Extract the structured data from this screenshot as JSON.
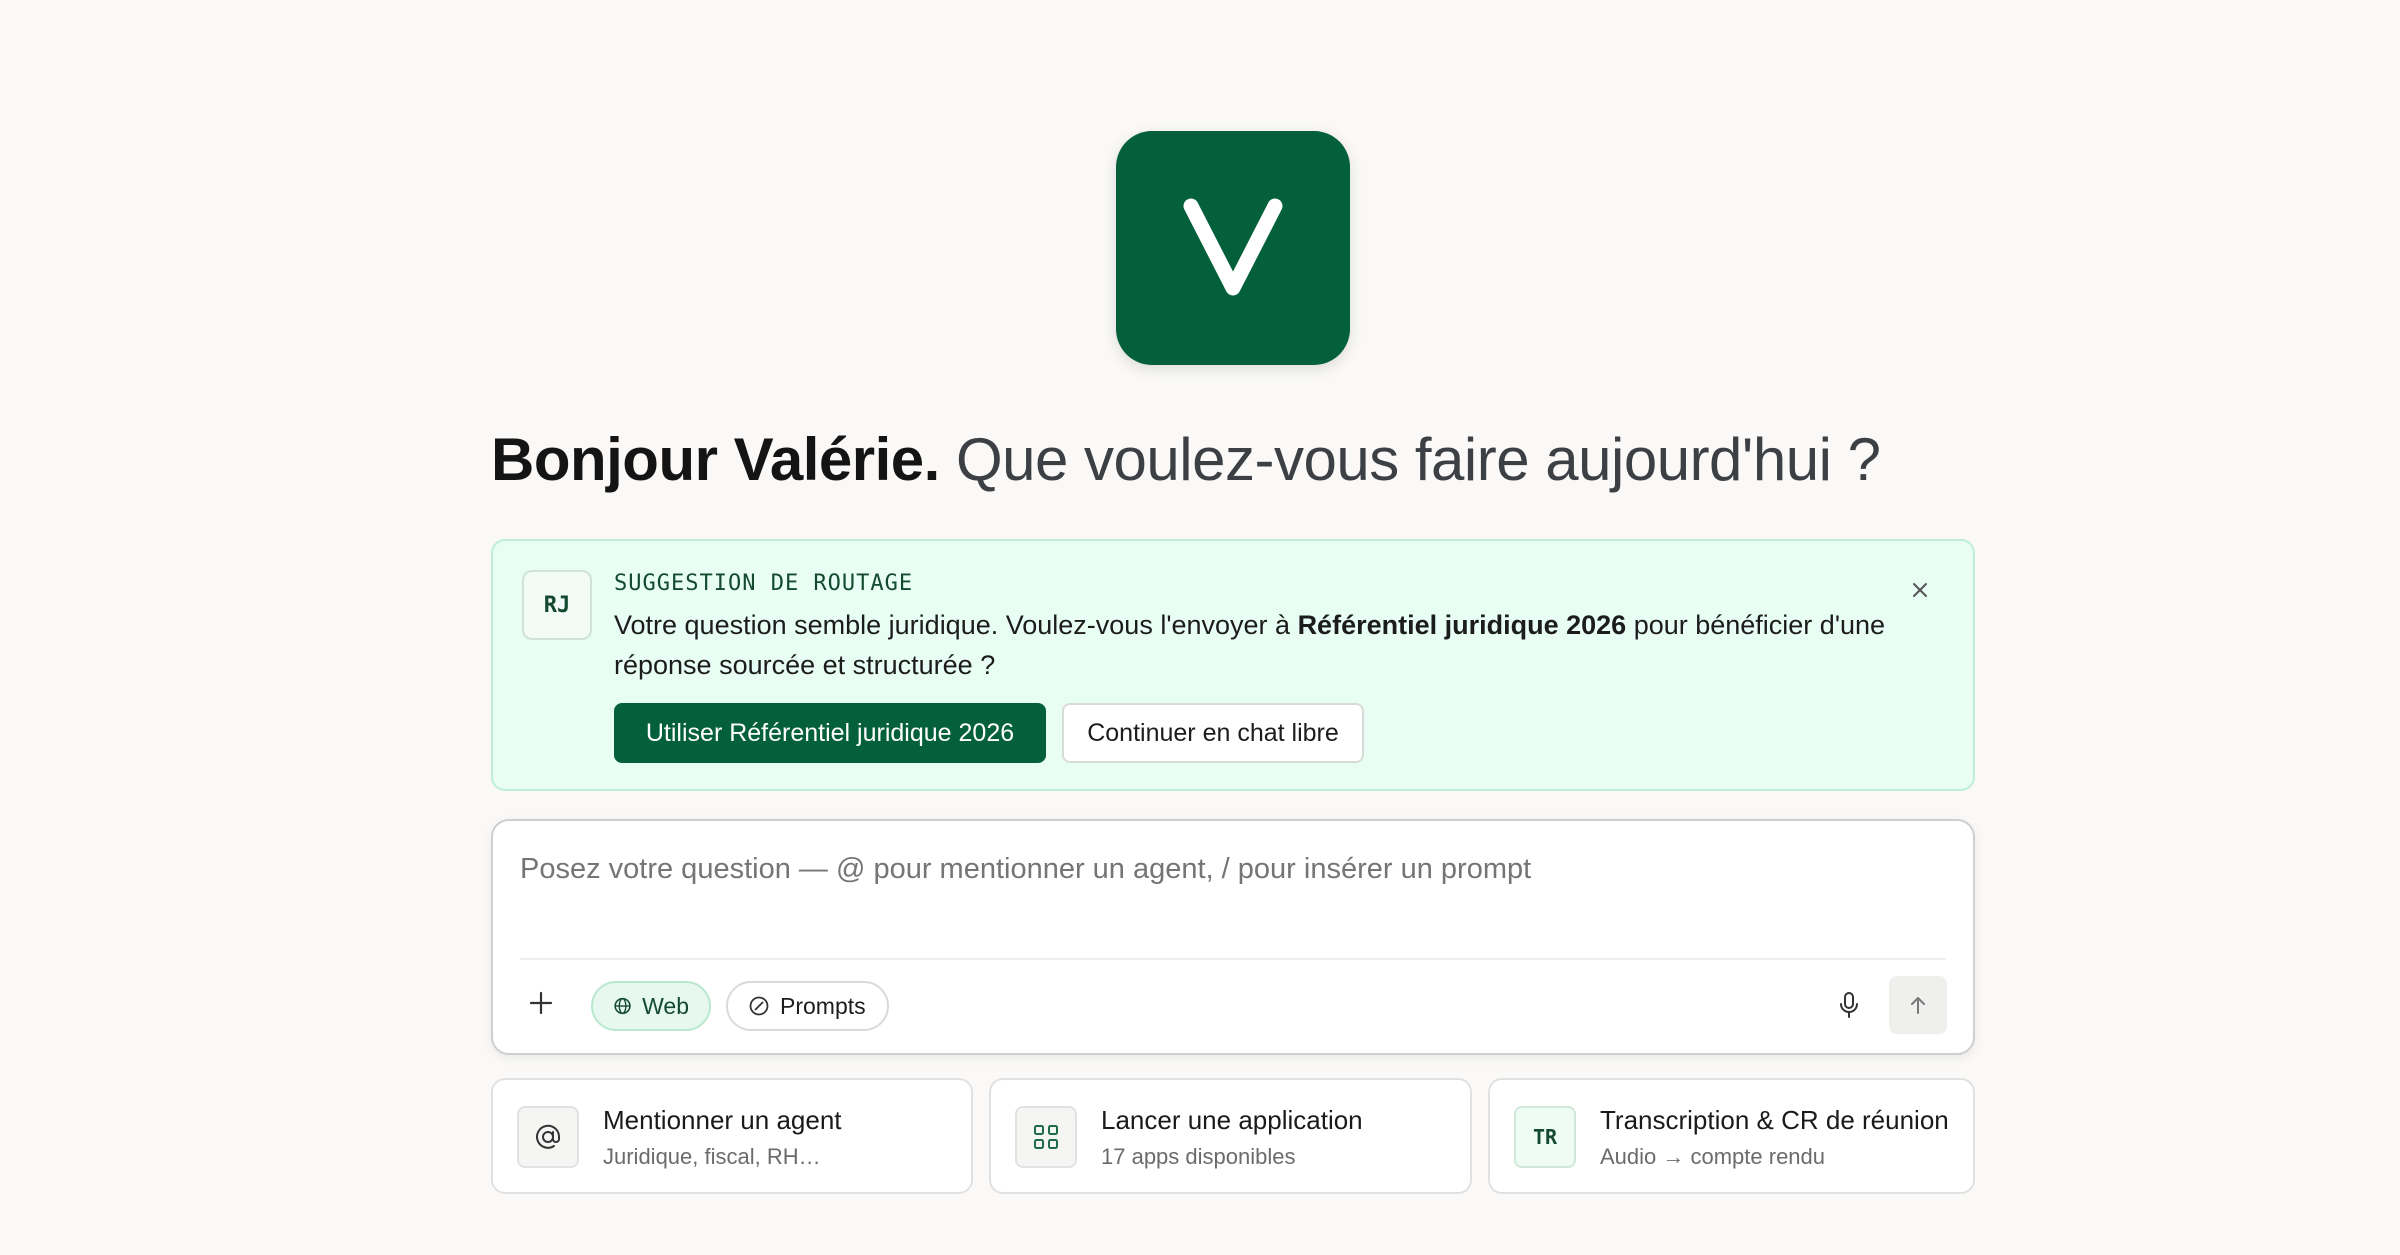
{
  "logo": {
    "letter": "V",
    "brand_color": "#04603a"
  },
  "greeting": {
    "hello": "Bonjour Valérie.",
    "question": "Que voulez-vous faire aujourd'hui ?"
  },
  "suggestion": {
    "avatar": "RJ",
    "tag": "SUGGESTION DE ROUTAGE",
    "text_before": "Votre question semble juridique. Voulez-vous l'envoyer à ",
    "text_bold": "Référentiel juridique 2026",
    "text_after": " pour bénéficier d'une réponse sourcée et structurée ?",
    "primary_label": "Utiliser Référentiel juridique 2026",
    "secondary_label": "Continuer en chat libre",
    "close_icon": "close-icon",
    "background": "#e8fdf3"
  },
  "composer": {
    "placeholder": "Posez votre question — @ pour mentionner un agent, / pour insérer un prompt",
    "web_label": "Web",
    "prompts_label": "Prompts",
    "icons": [
      "plus-icon",
      "globe-icon",
      "compass-icon",
      "microphone-icon",
      "arrow-up-icon"
    ]
  },
  "cards": [
    {
      "icon": "at-icon",
      "title": "Mentionner un agent",
      "subtitle": "Juridique, fiscal, RH…"
    },
    {
      "icon": "grid-icon",
      "title": "Lancer une application",
      "subtitle": "17 apps disponibles"
    },
    {
      "icon_text": "TR",
      "title": "Transcription & CR de réunion",
      "subtitle": "Audio → compte rendu"
    }
  ]
}
